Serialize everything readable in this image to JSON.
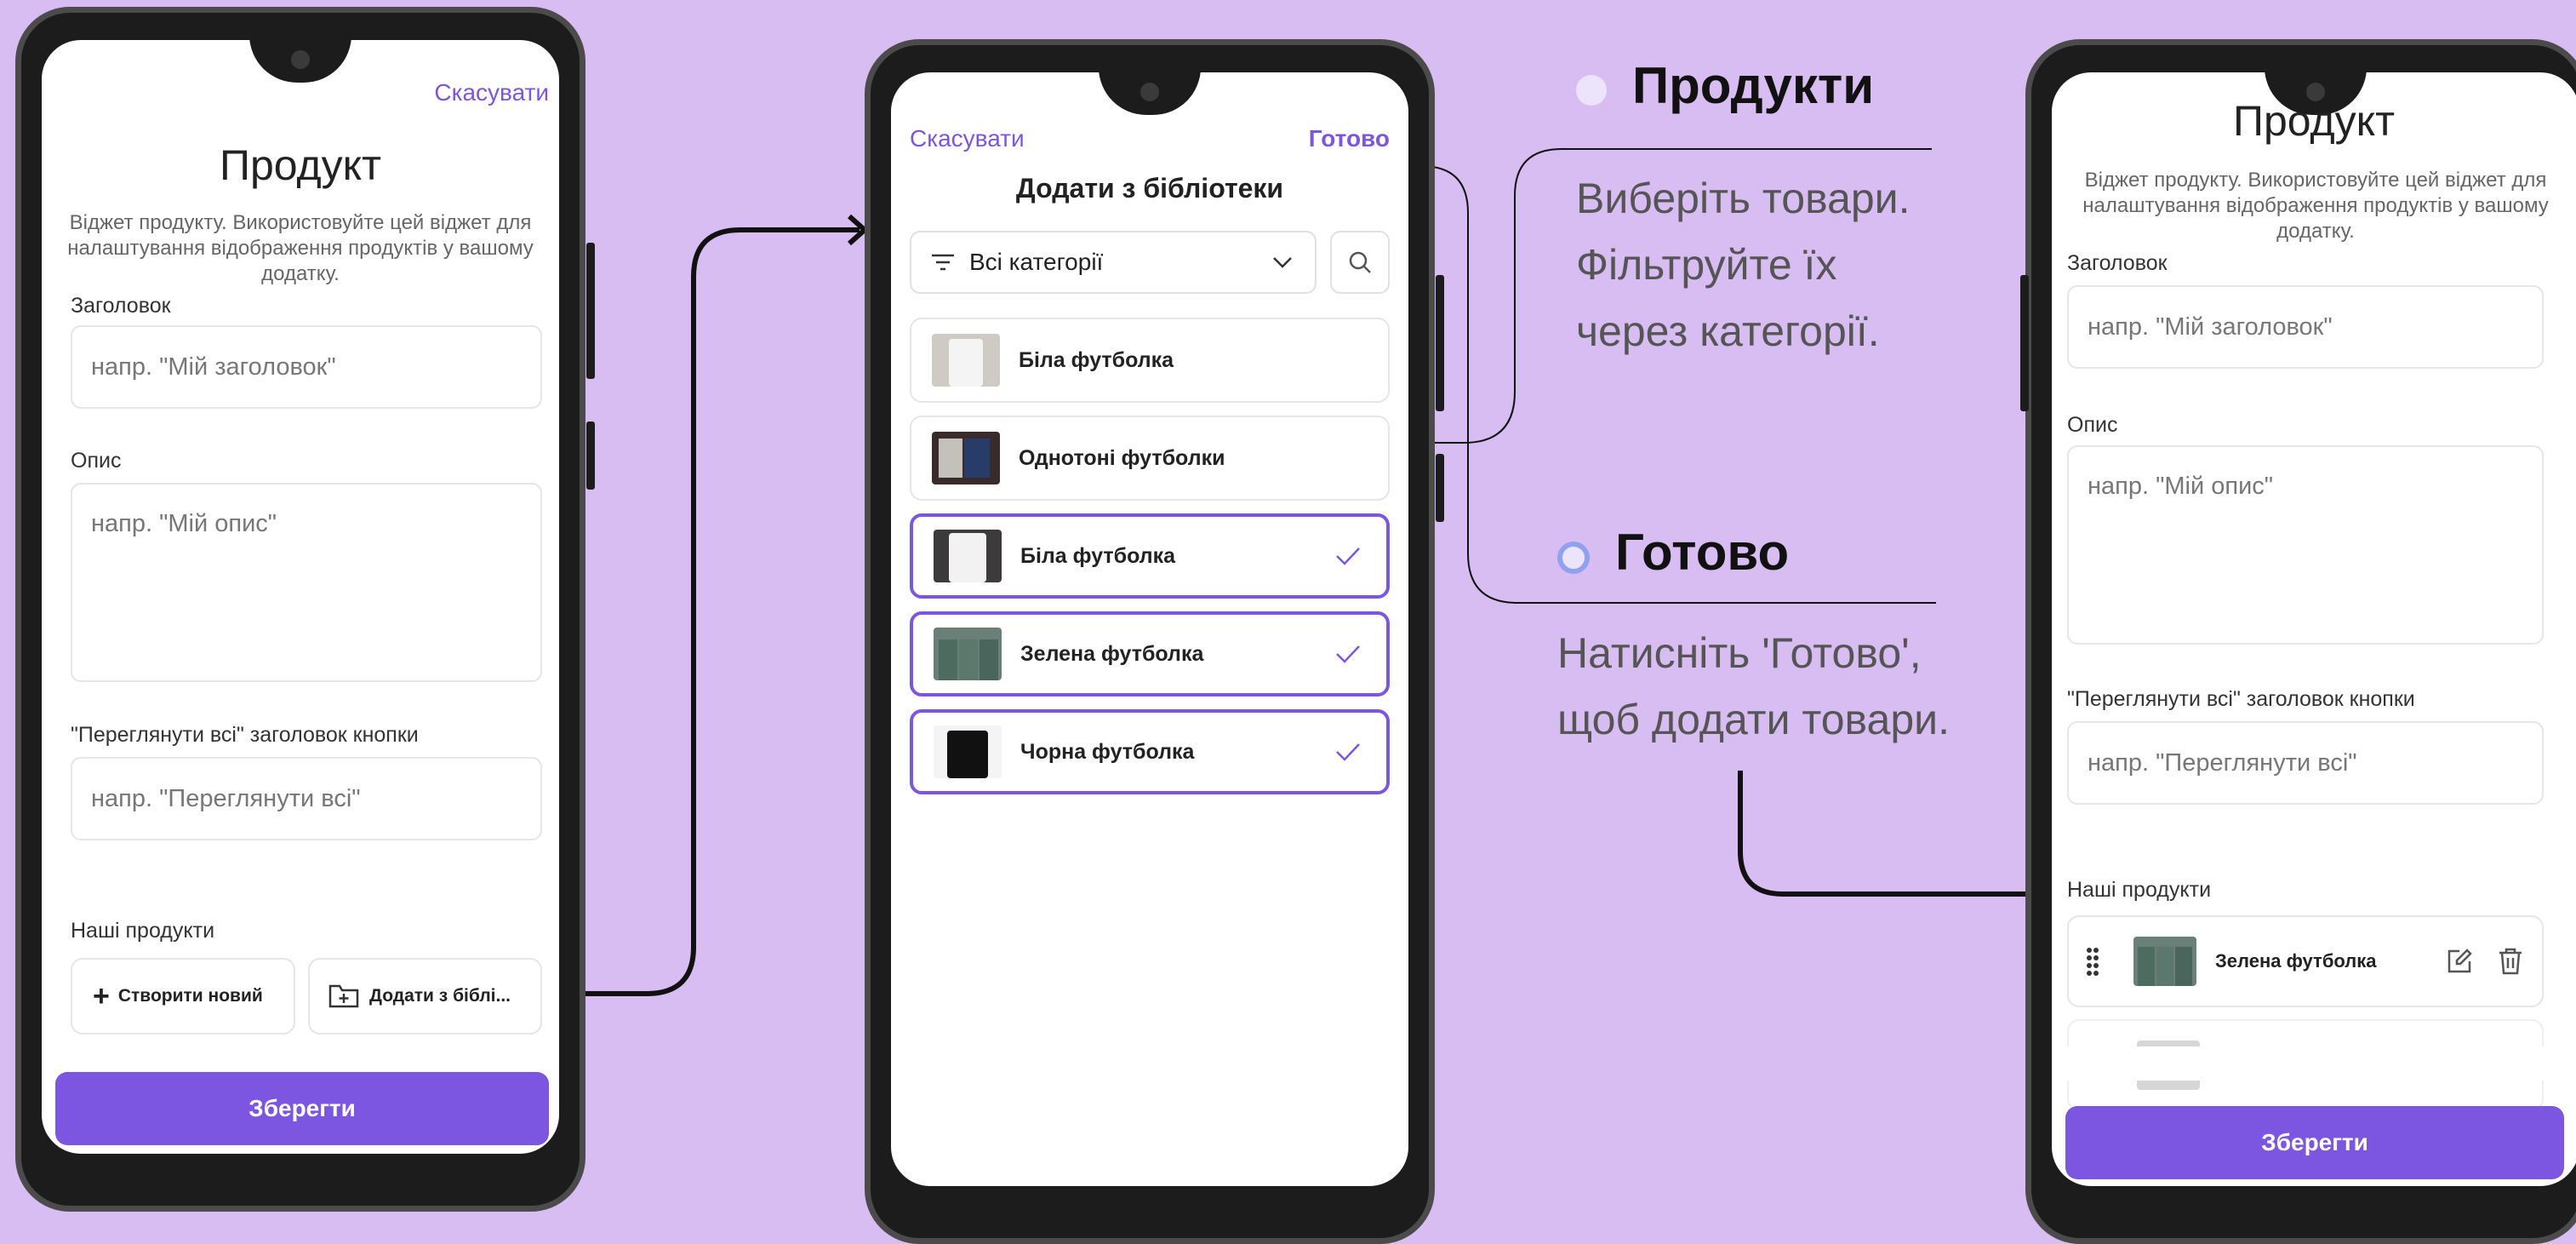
{
  "colors": {
    "background": "#d8bdf2",
    "accent": "#7c56e0",
    "dot1": "#ece4fb",
    "dot2": "#8fa2f0"
  },
  "phone1": {
    "cancel": "Скасувати",
    "title": "Продукт",
    "description": "Віджет продукту. Використовуйте цей віджет для налаштування відображення продуктів у вашому додатку.",
    "heading_label": "Заголовок",
    "heading_placeholder": "напр. \"Мій заголовок\"",
    "desc_label": "Опис",
    "desc_placeholder": "напр. \"Мій опис\"",
    "viewall_label": "\"Переглянути всі\" заголовок кнопки",
    "viewall_placeholder": "напр. \"Переглянути всі\"",
    "products_label": "Наші продукти",
    "create_new": "Створити новий",
    "add_library": "Додати з біблі...",
    "save": "Зберегти"
  },
  "phone2": {
    "cancel": "Скасувати",
    "done": "Готово",
    "title": "Додати з бібліотеки",
    "filter": "Всі категорії",
    "items": [
      {
        "name": "Біла футболка",
        "selected": false,
        "icon": "white-tshirt-thumb"
      },
      {
        "name": "Однотоні футболки",
        "selected": false,
        "icon": "plain-tshirts-thumb"
      },
      {
        "name": "Біла футболка",
        "selected": true,
        "icon": "white-tshirt-thumb"
      },
      {
        "name": "Зелена футболка",
        "selected": true,
        "icon": "green-tshirt-thumb"
      },
      {
        "name": "Чорна футболка",
        "selected": true,
        "icon": "black-tshirt-thumb"
      }
    ]
  },
  "annotations": {
    "products_title": "Продукти",
    "products_body_1": "Виберіть товари.",
    "products_body_2": "Фільтруйте їх",
    "products_body_3": "через категорії.",
    "done_title": "Готово",
    "done_body_1": "Натисніть 'Готово',",
    "done_body_2": "щоб додати товари."
  },
  "phone3": {
    "title": "Продукт",
    "description": "Віджет продукту. Використовуйте цей віджет для налаштування відображення продуктів у вашому додатку.",
    "heading_label": "Заголовок",
    "heading_placeholder": "напр. \"Мій заголовок\"",
    "desc_label": "Опис",
    "desc_placeholder": "напр. \"Мій опис\"",
    "viewall_label": "\"Переглянути всі\" заголовок кнопки",
    "viewall_placeholder": "напр. \"Переглянути всі\"",
    "products_label": "Наші продукти",
    "product_name": "Зелена футболка",
    "save": "Зберегти"
  }
}
